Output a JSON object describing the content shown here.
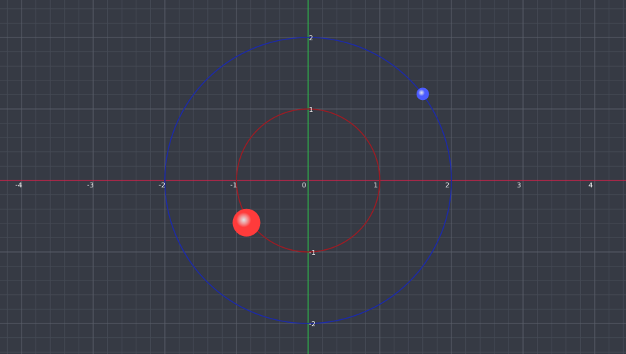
{
  "x_ticks": [
    {
      "value": -4,
      "label": "-4"
    },
    {
      "value": -3,
      "label": "-3"
    },
    {
      "value": -2,
      "label": "-2"
    },
    {
      "value": -1,
      "label": "-1"
    },
    {
      "value": 0,
      "label": "0"
    },
    {
      "value": 1,
      "label": "1"
    },
    {
      "value": 2,
      "label": "2"
    },
    {
      "value": 3,
      "label": "3"
    },
    {
      "value": 4,
      "label": "4"
    }
  ],
  "y_ticks": [
    {
      "value": 2,
      "label": "2"
    },
    {
      "value": 1,
      "label": "1"
    },
    {
      "value": -1,
      "label": "-1"
    },
    {
      "value": -2,
      "label": "-2"
    }
  ],
  "orbits": [
    {
      "name": "inner-orbit",
      "radius": 1,
      "color": "#9b1c24"
    },
    {
      "name": "outer-orbit",
      "radius": 2,
      "color": "#1c2aa8"
    }
  ],
  "bodies": [
    {
      "name": "red-body",
      "x": -0.86,
      "y": -0.59,
      "color": "#ff3b3b"
    },
    {
      "name": "blue-body",
      "x": 1.6,
      "y": 1.21,
      "color": "#4b5bff"
    }
  ],
  "colors": {
    "background": "#363a44",
    "grid_minor": "#454a55",
    "grid_major": "#5a5f6a",
    "x_axis": "#d4204a",
    "y_axis": "#2fa84a"
  }
}
